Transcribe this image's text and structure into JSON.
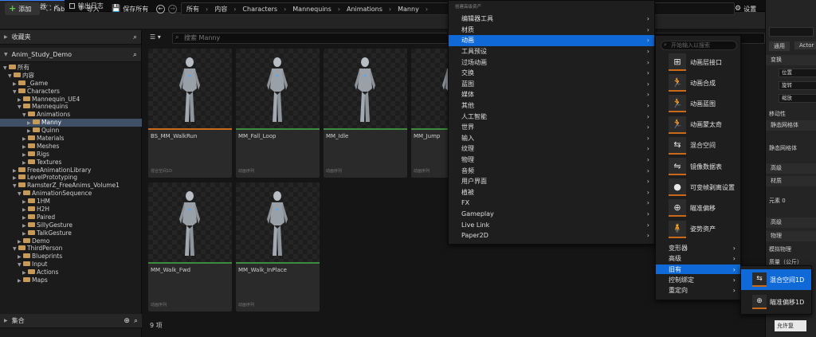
{
  "tabs": [
    {
      "label": "内容浏览器",
      "icon": "folder-icon"
    },
    {
      "label": "输出日志",
      "icon": "log-icon"
    }
  ],
  "toolbar": {
    "add_label": "添加",
    "fab_label": "Fab",
    "import_label": "导入",
    "save_all_label": "保存所有",
    "settings_label": "设置"
  },
  "breadcrumbs": [
    "所有",
    "内容",
    "Characters",
    "Mannequins",
    "Animations",
    "Manny"
  ],
  "left_panel": {
    "favorites_label": "收藏夹",
    "project_label": "Anim_Study_Demo",
    "collections_label": "集合",
    "tree": [
      {
        "label": "所有",
        "depth": 0,
        "open": true
      },
      {
        "label": "内容",
        "depth": 1,
        "open": true
      },
      {
        "label": "_Game",
        "depth": 2,
        "open": false
      },
      {
        "label": "Characters",
        "depth": 2,
        "open": true
      },
      {
        "label": "Mannequin_UE4",
        "depth": 3,
        "open": false
      },
      {
        "label": "Mannequins",
        "depth": 3,
        "open": true
      },
      {
        "label": "Animations",
        "depth": 4,
        "open": true
      },
      {
        "label": "Manny",
        "depth": 5,
        "open": false,
        "selected": true
      },
      {
        "label": "Quinn",
        "depth": 5,
        "open": false
      },
      {
        "label": "Materials",
        "depth": 4,
        "open": false
      },
      {
        "label": "Meshes",
        "depth": 4,
        "open": false
      },
      {
        "label": "Rigs",
        "depth": 4,
        "open": false
      },
      {
        "label": "Textures",
        "depth": 4,
        "open": false
      },
      {
        "label": "FreeAnimationLibrary",
        "depth": 2,
        "open": false
      },
      {
        "label": "LevelPrototyping",
        "depth": 2,
        "open": false
      },
      {
        "label": "RamsterZ_FreeAnims_Volume1",
        "depth": 2,
        "open": true
      },
      {
        "label": "AnimationSequence",
        "depth": 3,
        "open": true
      },
      {
        "label": "1HM",
        "depth": 4,
        "open": false
      },
      {
        "label": "H2H",
        "depth": 4,
        "open": false
      },
      {
        "label": "Paired",
        "depth": 4,
        "open": false
      },
      {
        "label": "SillyGesture",
        "depth": 4,
        "open": false
      },
      {
        "label": "TalkGesture",
        "depth": 4,
        "open": false
      },
      {
        "label": "Demo",
        "depth": 3,
        "open": false
      },
      {
        "label": "ThirdPerson",
        "depth": 2,
        "open": true
      },
      {
        "label": "Blueprints",
        "depth": 3,
        "open": false
      },
      {
        "label": "Input",
        "depth": 3,
        "open": true
      },
      {
        "label": "Actions",
        "depth": 4,
        "open": false
      },
      {
        "label": "Maps",
        "depth": 3,
        "open": false
      }
    ]
  },
  "content": {
    "search_placeholder": "搜索 Manny",
    "item_count": "9 项",
    "assets": [
      {
        "name": "BS_MM_WalkRun",
        "type": "混合空间1D",
        "color": "#c86a1a"
      },
      {
        "name": "MM_Fall_Loop",
        "type": "动画序列",
        "color": "#3e8a3e"
      },
      {
        "name": "MM_Idle",
        "type": "动画序列",
        "color": "#3e8a3e"
      },
      {
        "name": "MM_Jump",
        "type": "动画序列",
        "color": "#3e8a3e"
      },
      {
        "name": "MM_Walk_Fwd",
        "type": "动画序列",
        "color": "#3e8a3e"
      },
      {
        "name": "MM_Walk_InPlace",
        "type": "动画序列",
        "color": "#3e8a3e"
      }
    ]
  },
  "context_menu": {
    "header": "创建高级资产",
    "items": [
      {
        "label": "编辑器工具",
        "sub": true
      },
      {
        "label": "材质",
        "sub": true
      },
      {
        "label": "动画",
        "sub": true,
        "highlight": true
      },
      {
        "label": "工具预设",
        "sub": true
      },
      {
        "label": "过场动画",
        "sub": true
      },
      {
        "label": "交换",
        "sub": true
      },
      {
        "label": "蓝图",
        "sub": true
      },
      {
        "label": "媒体",
        "sub": true
      },
      {
        "label": "其他",
        "sub": true
      },
      {
        "label": "人工智能",
        "sub": true
      },
      {
        "label": "世界",
        "sub": true
      },
      {
        "label": "输入",
        "sub": true
      },
      {
        "label": "纹理",
        "sub": true
      },
      {
        "label": "物理",
        "sub": true
      },
      {
        "label": "音频",
        "sub": true
      },
      {
        "label": "用户界面",
        "sub": true
      },
      {
        "label": "植被",
        "sub": true
      },
      {
        "label": "FX",
        "sub": true
      },
      {
        "label": "Gameplay",
        "sub": true
      },
      {
        "label": "Live Link",
        "sub": true
      },
      {
        "label": "Paper2D",
        "sub": true
      }
    ]
  },
  "anim_submenu": {
    "search_placeholder": "开始输入以搜索",
    "items": [
      {
        "label": "动画层接口",
        "icon": "anim-layer-interface-icon",
        "glyph": "⊞"
      },
      {
        "label": "动画合成",
        "icon": "anim-composite-icon",
        "glyph": "🏃"
      },
      {
        "label": "动画蓝图",
        "icon": "anim-blueprint-icon",
        "glyph": "🏃"
      },
      {
        "label": "动画蒙太奇",
        "icon": "anim-montage-icon",
        "glyph": "🏃"
      },
      {
        "label": "混合空间",
        "icon": "blend-space-icon",
        "glyph": "⇆"
      },
      {
        "label": "镜像数据表",
        "icon": "mirror-data-table-icon",
        "glyph": "⇋"
      },
      {
        "label": "可变帧剥离设置",
        "icon": "variable-frame-strip-icon",
        "glyph": "●"
      },
      {
        "label": "瞄准偏移",
        "icon": "aim-offset-icon",
        "glyph": "⊕"
      },
      {
        "label": "姿势资产",
        "icon": "pose-asset-icon",
        "glyph": "🧍"
      }
    ],
    "rows": [
      {
        "label": "变形器",
        "highlight": false
      },
      {
        "label": "高级",
        "highlight": false
      },
      {
        "label": "旧有",
        "highlight": true
      },
      {
        "label": "控制绑定",
        "highlight": false
      },
      {
        "label": "重定向",
        "highlight": false
      }
    ]
  },
  "legacy_submenu": {
    "items": [
      {
        "label": "混合空间1D",
        "icon": "blend-space-1d-icon",
        "glyph": "⇆",
        "highlight": true
      },
      {
        "label": "瞄准偏移1D",
        "icon": "aim-offset-1d-icon",
        "glyph": "⊕",
        "highlight": false
      }
    ]
  },
  "tooltip": "允许复",
  "details": {
    "btn_general": "通用",
    "btn_actor": "Actor",
    "sec_transform": "变换",
    "position": "位置",
    "rotation": "旋转",
    "scale": "缩放",
    "mobility": "移动性",
    "sec_static_mesh": "静态网格体",
    "static_mesh": "静态网格体",
    "sec_advanced": "高级",
    "sec_materials": "材质",
    "element0": "元素 0",
    "sec_advanced2": "高级",
    "sec_physics": "物理",
    "simulate_physics": "模拟物理",
    "mass": "质量（公斤）"
  }
}
